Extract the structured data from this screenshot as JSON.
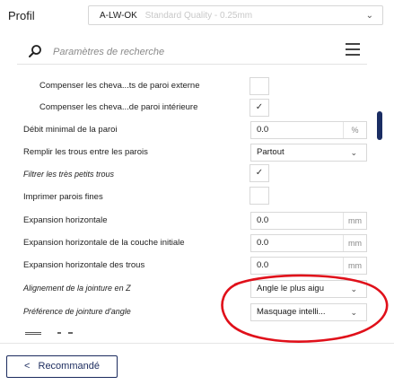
{
  "profile": {
    "label": "Profil",
    "name": "A-LW-OK",
    "quality": "Standard Quality - 0.25mm"
  },
  "search": {
    "placeholder": "Paramètres de recherche"
  },
  "settings": [
    {
      "label": "Compenser les cheva...ts de paroi externe",
      "control": "checkbox",
      "checked": false
    },
    {
      "label": "Compenser les cheva...de paroi intérieure",
      "control": "checkbox",
      "checked": true,
      "check": "✓"
    },
    {
      "label": "Débit minimal de la paroi",
      "control": "number",
      "value": "0.0",
      "unit": "%"
    },
    {
      "label": "Remplir les trous entre les parois",
      "control": "select",
      "value": "Partout"
    },
    {
      "label": "Filtrer les très petits trous",
      "control": "checkbox",
      "checked": true,
      "check": "✓"
    },
    {
      "label": "Imprimer parois fines",
      "control": "checkbox",
      "checked": false
    },
    {
      "label": "Expansion horizontale",
      "control": "number",
      "value": "0.0",
      "unit": "mm"
    },
    {
      "label": "Expansion horizontale de la couche initiale",
      "control": "number",
      "value": "0.0",
      "unit": "mm"
    },
    {
      "label": "Expansion horizontale des trous",
      "control": "number",
      "value": "0.0",
      "unit": "mm"
    },
    {
      "label": "Alignement de la jointure en Z",
      "control": "select",
      "value": "Angle le plus aigu"
    },
    {
      "label": "Préférence de jointure d'angle",
      "control": "select",
      "value": "Masquage intelli..."
    }
  ],
  "footer": {
    "recommended_label": "Recommandé",
    "chevron": "<"
  },
  "colors": {
    "accent": "#1b2b5e",
    "annotation": "#e0101a",
    "scrollbar": "#1a2d63"
  }
}
